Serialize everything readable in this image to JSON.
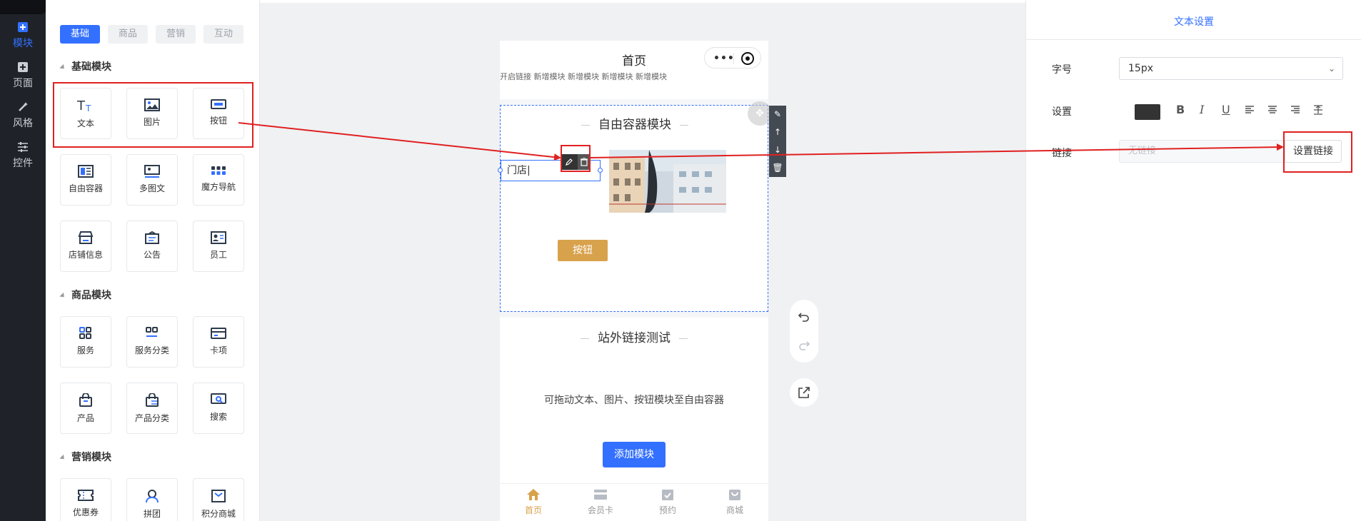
{
  "nav": {
    "items": [
      {
        "label": "模块",
        "icon": "plus-square-icon",
        "active": true
      },
      {
        "label": "页面",
        "icon": "page-plus-icon",
        "active": false
      },
      {
        "label": "风格",
        "icon": "magic-wand-icon",
        "active": false
      },
      {
        "label": "控件",
        "icon": "sliders-icon",
        "active": false
      }
    ]
  },
  "modules": {
    "tabs": [
      {
        "label": "基础",
        "active": true
      },
      {
        "label": "商品",
        "active": false
      },
      {
        "label": "营销",
        "active": false
      },
      {
        "label": "互动",
        "active": false
      }
    ],
    "sections": [
      {
        "title": "基础模块",
        "items": [
          {
            "label": "文本",
            "icon": "text-icon"
          },
          {
            "label": "图片",
            "icon": "image-icon"
          },
          {
            "label": "按钮",
            "icon": "button-icon"
          },
          {
            "label": "自由容器",
            "icon": "free-container-icon"
          },
          {
            "label": "多图文",
            "icon": "multi-image-text-icon"
          },
          {
            "label": "魔方导航",
            "icon": "grid-nav-icon"
          },
          {
            "label": "店铺信息",
            "icon": "store-icon"
          },
          {
            "label": "公告",
            "icon": "announcement-icon"
          },
          {
            "label": "员工",
            "icon": "staff-card-icon"
          }
        ]
      },
      {
        "title": "商品模块",
        "items": [
          {
            "label": "服务",
            "icon": "service-grid-icon"
          },
          {
            "label": "服务分类",
            "icon": "service-category-icon"
          },
          {
            "label": "卡项",
            "icon": "card-icon"
          },
          {
            "label": "产品",
            "icon": "bag-icon"
          },
          {
            "label": "产品分类",
            "icon": "bag-list-icon"
          },
          {
            "label": "搜索",
            "icon": "search-icon"
          }
        ]
      },
      {
        "title": "营销模块",
        "items": [
          {
            "label": "优惠券",
            "icon": "coupon-icon"
          },
          {
            "label": "拼团",
            "icon": "group-buy-icon"
          },
          {
            "label": "积分商城",
            "icon": "points-mall-icon"
          }
        ]
      }
    ]
  },
  "phone": {
    "title": "首页",
    "cut_text": "开启链接    新增模块    新增模块    新增模块    新增模块",
    "container_title": "自由容器模块",
    "text_value": "门店",
    "button_label": "按钮",
    "section2_title": "站外链接测试",
    "hint": "可拖动文本、图片、按钮模块至自由容器",
    "add_button": "添加模块",
    "tabbar": [
      {
        "label": "首页",
        "icon": "home-icon",
        "active": true
      },
      {
        "label": "会员卡",
        "icon": "member-card-icon",
        "active": false
      },
      {
        "label": "预约",
        "icon": "booking-icon",
        "active": false
      },
      {
        "label": "商城",
        "icon": "mall-icon",
        "active": false
      }
    ]
  },
  "settings": {
    "title": "文本设置",
    "font_size_label": "字号",
    "font_size_value": "15px",
    "style_label": "设置",
    "text_color": "#333333",
    "link_label": "链接",
    "link_placeholder": "无链接",
    "link_button": "设置链接"
  },
  "colors": {
    "accent": "#3370ff",
    "button_gold": "#d8a24c",
    "annotation_red": "#e02020"
  }
}
